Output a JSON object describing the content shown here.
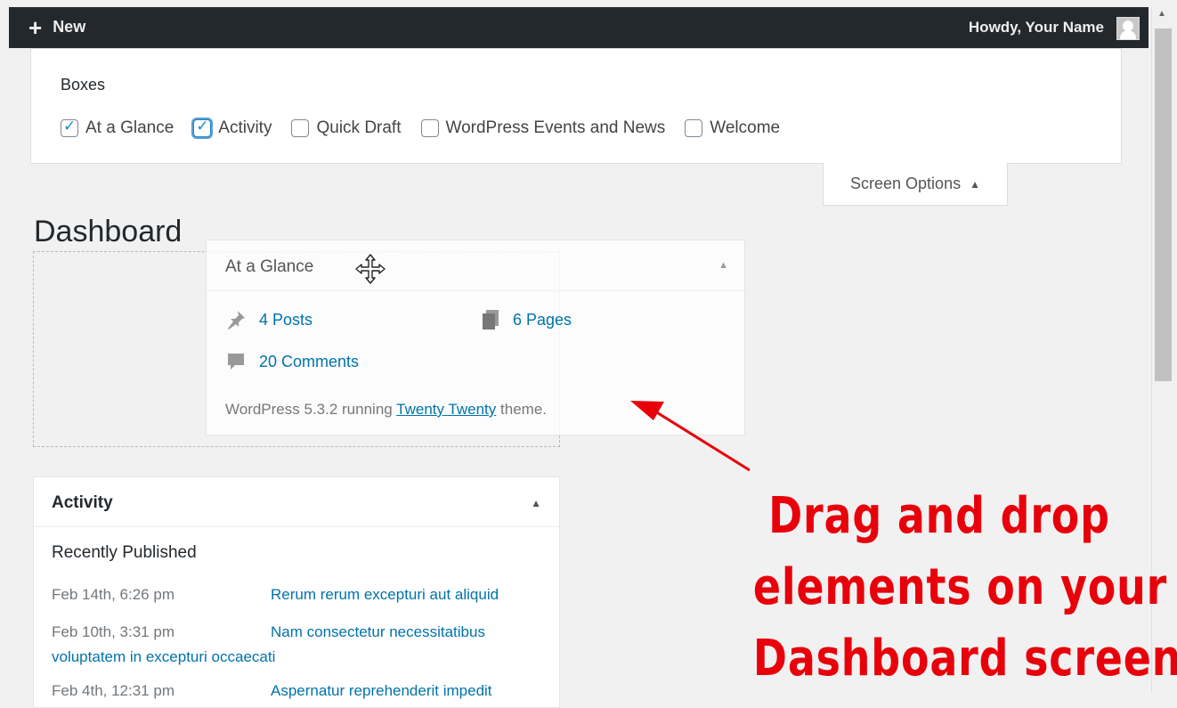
{
  "admin_bar": {
    "new_label": "New",
    "howdy_label": "Howdy, Your Name"
  },
  "screen_options": {
    "boxes_title": "Boxes",
    "options": [
      {
        "label": "At a Glance",
        "checked": true
      },
      {
        "label": "Activity",
        "checked": true
      },
      {
        "label": "Quick Draft",
        "checked": false
      },
      {
        "label": "WordPress Events and News",
        "checked": false
      },
      {
        "label": "Welcome",
        "checked": false
      }
    ],
    "tab_label": "Screen Options"
  },
  "page_title": "Dashboard",
  "at_a_glance": {
    "title": "At a Glance",
    "posts": "4 Posts",
    "pages": "6 Pages",
    "comments": "20 Comments",
    "footer_prefix": "WordPress 5.3.2 running ",
    "theme_link": "Twenty Twenty",
    "footer_suffix": " theme."
  },
  "activity": {
    "title": "Activity",
    "subtitle": "Recently Published",
    "items": [
      {
        "date": "Feb 14th, 6:26 pm",
        "title": "Rerum rerum excepturi aut aliquid",
        "title_wrap": ""
      },
      {
        "date": "Feb 10th, 3:31 pm",
        "title": "Nam consectetur necessitatibus",
        "title_wrap": "voluptatem in excepturi occaecati"
      },
      {
        "date": "Feb 4th, 12:31 pm",
        "title": "Aspernatur reprehenderit impedit",
        "title_wrap": ""
      }
    ]
  },
  "annotation": {
    "lines": [
      "Drag and drop",
      "elements on your",
      "Dashboard screen"
    ],
    "color": "#e8000b"
  }
}
